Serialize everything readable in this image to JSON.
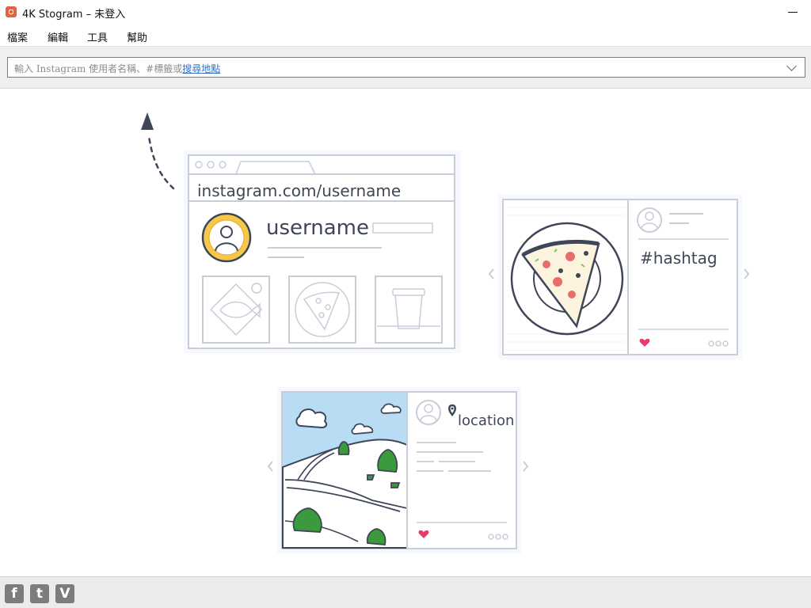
{
  "window": {
    "title": "4K Stogram – 未登入"
  },
  "menu": {
    "items": [
      "檔案",
      "編輯",
      "工具",
      "幫助"
    ]
  },
  "search": {
    "placeholder_prefix": "輸入 Instagram 使用者名稱、#標籤或",
    "placeholder_link": "搜尋地點"
  },
  "illustration": {
    "profile_url": "instagram.com/username",
    "profile_name": "username",
    "hashtag_label": "#hashtag",
    "location_label": "location"
  },
  "social": {
    "facebook": "f",
    "twitter": "t",
    "vimeo": "V"
  },
  "colors": {
    "accent": "#e8603c",
    "link": "#2f6fc9",
    "sketch": "#3e4658",
    "sky": "#b7dcf3",
    "tree": "#3b9a3b",
    "heart": "#e73b6b"
  },
  "icons": {
    "arrow": "arrow-up-icon",
    "chevron": "chevron-down-icon"
  }
}
